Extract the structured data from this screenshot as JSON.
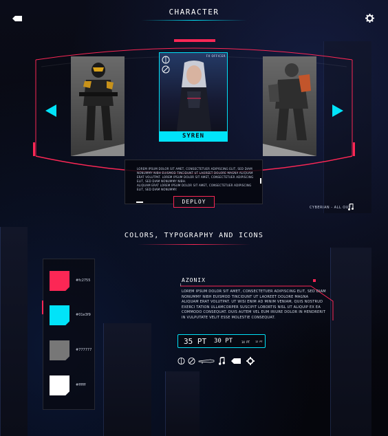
{
  "header": {
    "title": "CHARACTER"
  },
  "character": {
    "name": "SYREN",
    "rank": "FX OFFICER",
    "description": [
      "LOREM IPSUM DOLOR SIT AMET, CONSECTETUER ADIPISCING ELIT, SED DIAM NONUMMY NIBH EUISMOD TINCIDUNT UT LAOREET DOLORE MAGNA ALIQUAM ERAT VOLUTPAT. LOREM IPSUM DOLOR SIT AMET, CONSECTETUER ADIPISCING ELIT, SED DIAM NONUMMY NIBH.",
      "ALIQUAM ERAT LOREM IPSUM DOLOR SIT AMET, CONSECTETUER ADIPISCING ELIT, SED DIAM NONUMMY."
    ],
    "deploy_label": "DEPLOY"
  },
  "music": {
    "track": "CYBERIAN - ALL OUT"
  },
  "style_guide": {
    "title": "COLORS, TYPOGRAPHY AND ICONS",
    "colors": [
      {
        "hex": "#fc2755",
        "label": "#fc2755"
      },
      {
        "hex": "#01e3f9",
        "label": "#01e3f9"
      },
      {
        "hex": "#777777",
        "label": "#777777"
      },
      {
        "hex": "#ffffff",
        "label": "#ffffff"
      }
    ],
    "font_name": "AZONIX",
    "font_sample": "LOREM IPSUM DOLOR SIT AMET, CONSECTETUER ADIPISCING ELIT, SED DIAM NONUMMY NIBH EUISMOD TINCIDUNT UT LAOREET DOLORE MAGNA ALIQUAM ERAT VOLUTPAT. UT WISI ENIM AD MINIM VENIAM, QUIS NOSTRUD EXERCI TATION ULLAMCORPER SUSCIPIT LOBORTIS NISL UT ALIQUIP EX EA COMMODO CONSEQUAT. DUIS AUTEM VEL EUM IRIURE DOLOR IN HENDRERIT IN VULPUTATE VELIT ESSE MOLESTIE CONSEQUAT.",
    "sizes": [
      "35 PT",
      "30 PT",
      "14 PT",
      "12 PT"
    ],
    "icons": [
      "crosshair-icon",
      "compass-icon",
      "weapon-icon",
      "music-note-icon",
      "back-arrow-icon",
      "gear-icon"
    ]
  },
  "accent": {
    "primary": "#fc2755",
    "secondary": "#01e3f9"
  }
}
